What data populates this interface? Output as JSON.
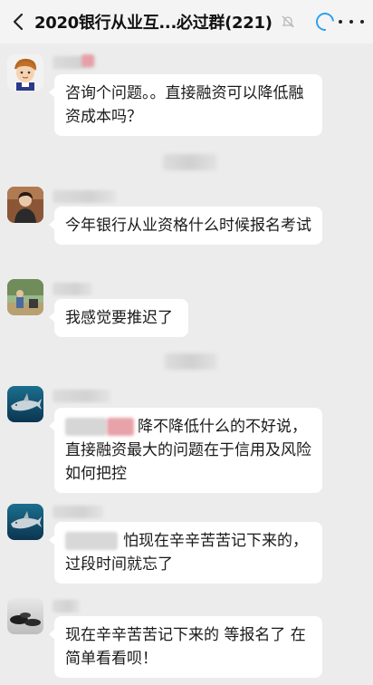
{
  "header": {
    "back_icon": "chevron-left-icon",
    "title": "2020银行从业互...必过群(221)",
    "mute_icon": "bell-off-icon",
    "loading_icon": "loading-spinner-icon",
    "more_icon": "more-dots-icon",
    "accent": "#2f9ef0"
  },
  "messages": [
    {
      "avatar": "cartoon-boy-avatar",
      "text": "咨询个问题。。直接融资可以降低融资成本吗？"
    },
    {
      "avatar": "person-photo-avatar",
      "text": "今年银行从业资格什么时候报名考试"
    },
    {
      "avatar": "outdoor-photo-avatar",
      "text": "我感觉要推迟了"
    },
    {
      "avatar": "shark-avatar",
      "text": "降不降低什么的不好说，直接融资最大的问题在于信用及风险如何把控"
    },
    {
      "avatar": "shark-avatar",
      "text": "怕现在辛辛苦苦记下来的，过段时间就忘了"
    },
    {
      "avatar": "stones-avatar",
      "text": "现在辛辛苦苦记下来的 等报名了 在简单看看呗！"
    }
  ]
}
